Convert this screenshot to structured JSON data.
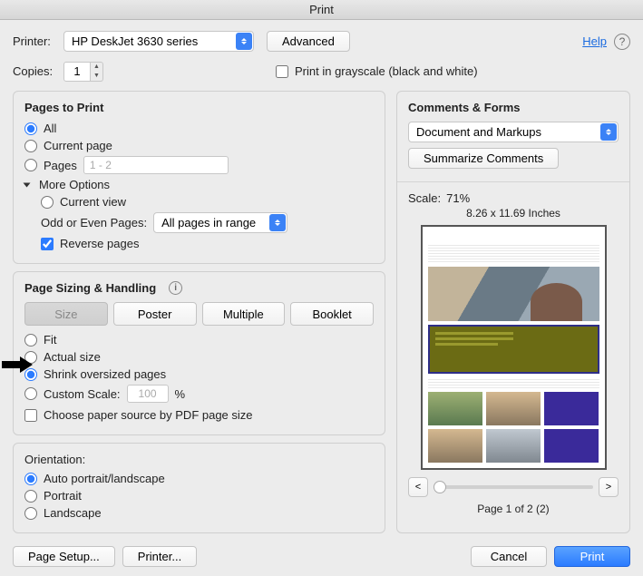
{
  "window": {
    "title": "Print"
  },
  "header": {
    "printer_label": "Printer:",
    "printer_value": "HP DeskJet 3630 series",
    "advanced": "Advanced",
    "help": "Help",
    "copies_label": "Copies:",
    "copies_value": "1",
    "grayscale_label": "Print in grayscale (black and white)"
  },
  "pages": {
    "heading": "Pages to Print",
    "all": "All",
    "current": "Current page",
    "pages_label": "Pages",
    "pages_range": "1 - 2",
    "more": "More Options",
    "current_view": "Current view",
    "odd_even_label": "Odd or Even Pages:",
    "odd_even_value": "All pages in range",
    "reverse": "Reverse pages"
  },
  "sizing": {
    "heading": "Page Sizing & Handling",
    "size": "Size",
    "poster": "Poster",
    "multiple": "Multiple",
    "booklet": "Booklet",
    "fit": "Fit",
    "actual": "Actual size",
    "shrink": "Shrink oversized pages",
    "custom": "Custom Scale:",
    "custom_value": "100",
    "percent": "%",
    "choose_paper": "Choose paper source by PDF page size"
  },
  "orientation": {
    "heading": "Orientation:",
    "auto": "Auto portrait/landscape",
    "portrait": "Portrait",
    "landscape": "Landscape"
  },
  "comments": {
    "heading": "Comments & Forms",
    "mode": "Document and Markups",
    "summarize": "Summarize Comments",
    "scale_label": "Scale:",
    "scale_value": "71%",
    "dimensions": "8.26 x 11.69 Inches",
    "page_indicator": "Page 1 of 2 (2)",
    "prev": "<",
    "next": ">"
  },
  "footer": {
    "page_setup": "Page Setup...",
    "printer_btn": "Printer...",
    "cancel": "Cancel",
    "print": "Print"
  }
}
